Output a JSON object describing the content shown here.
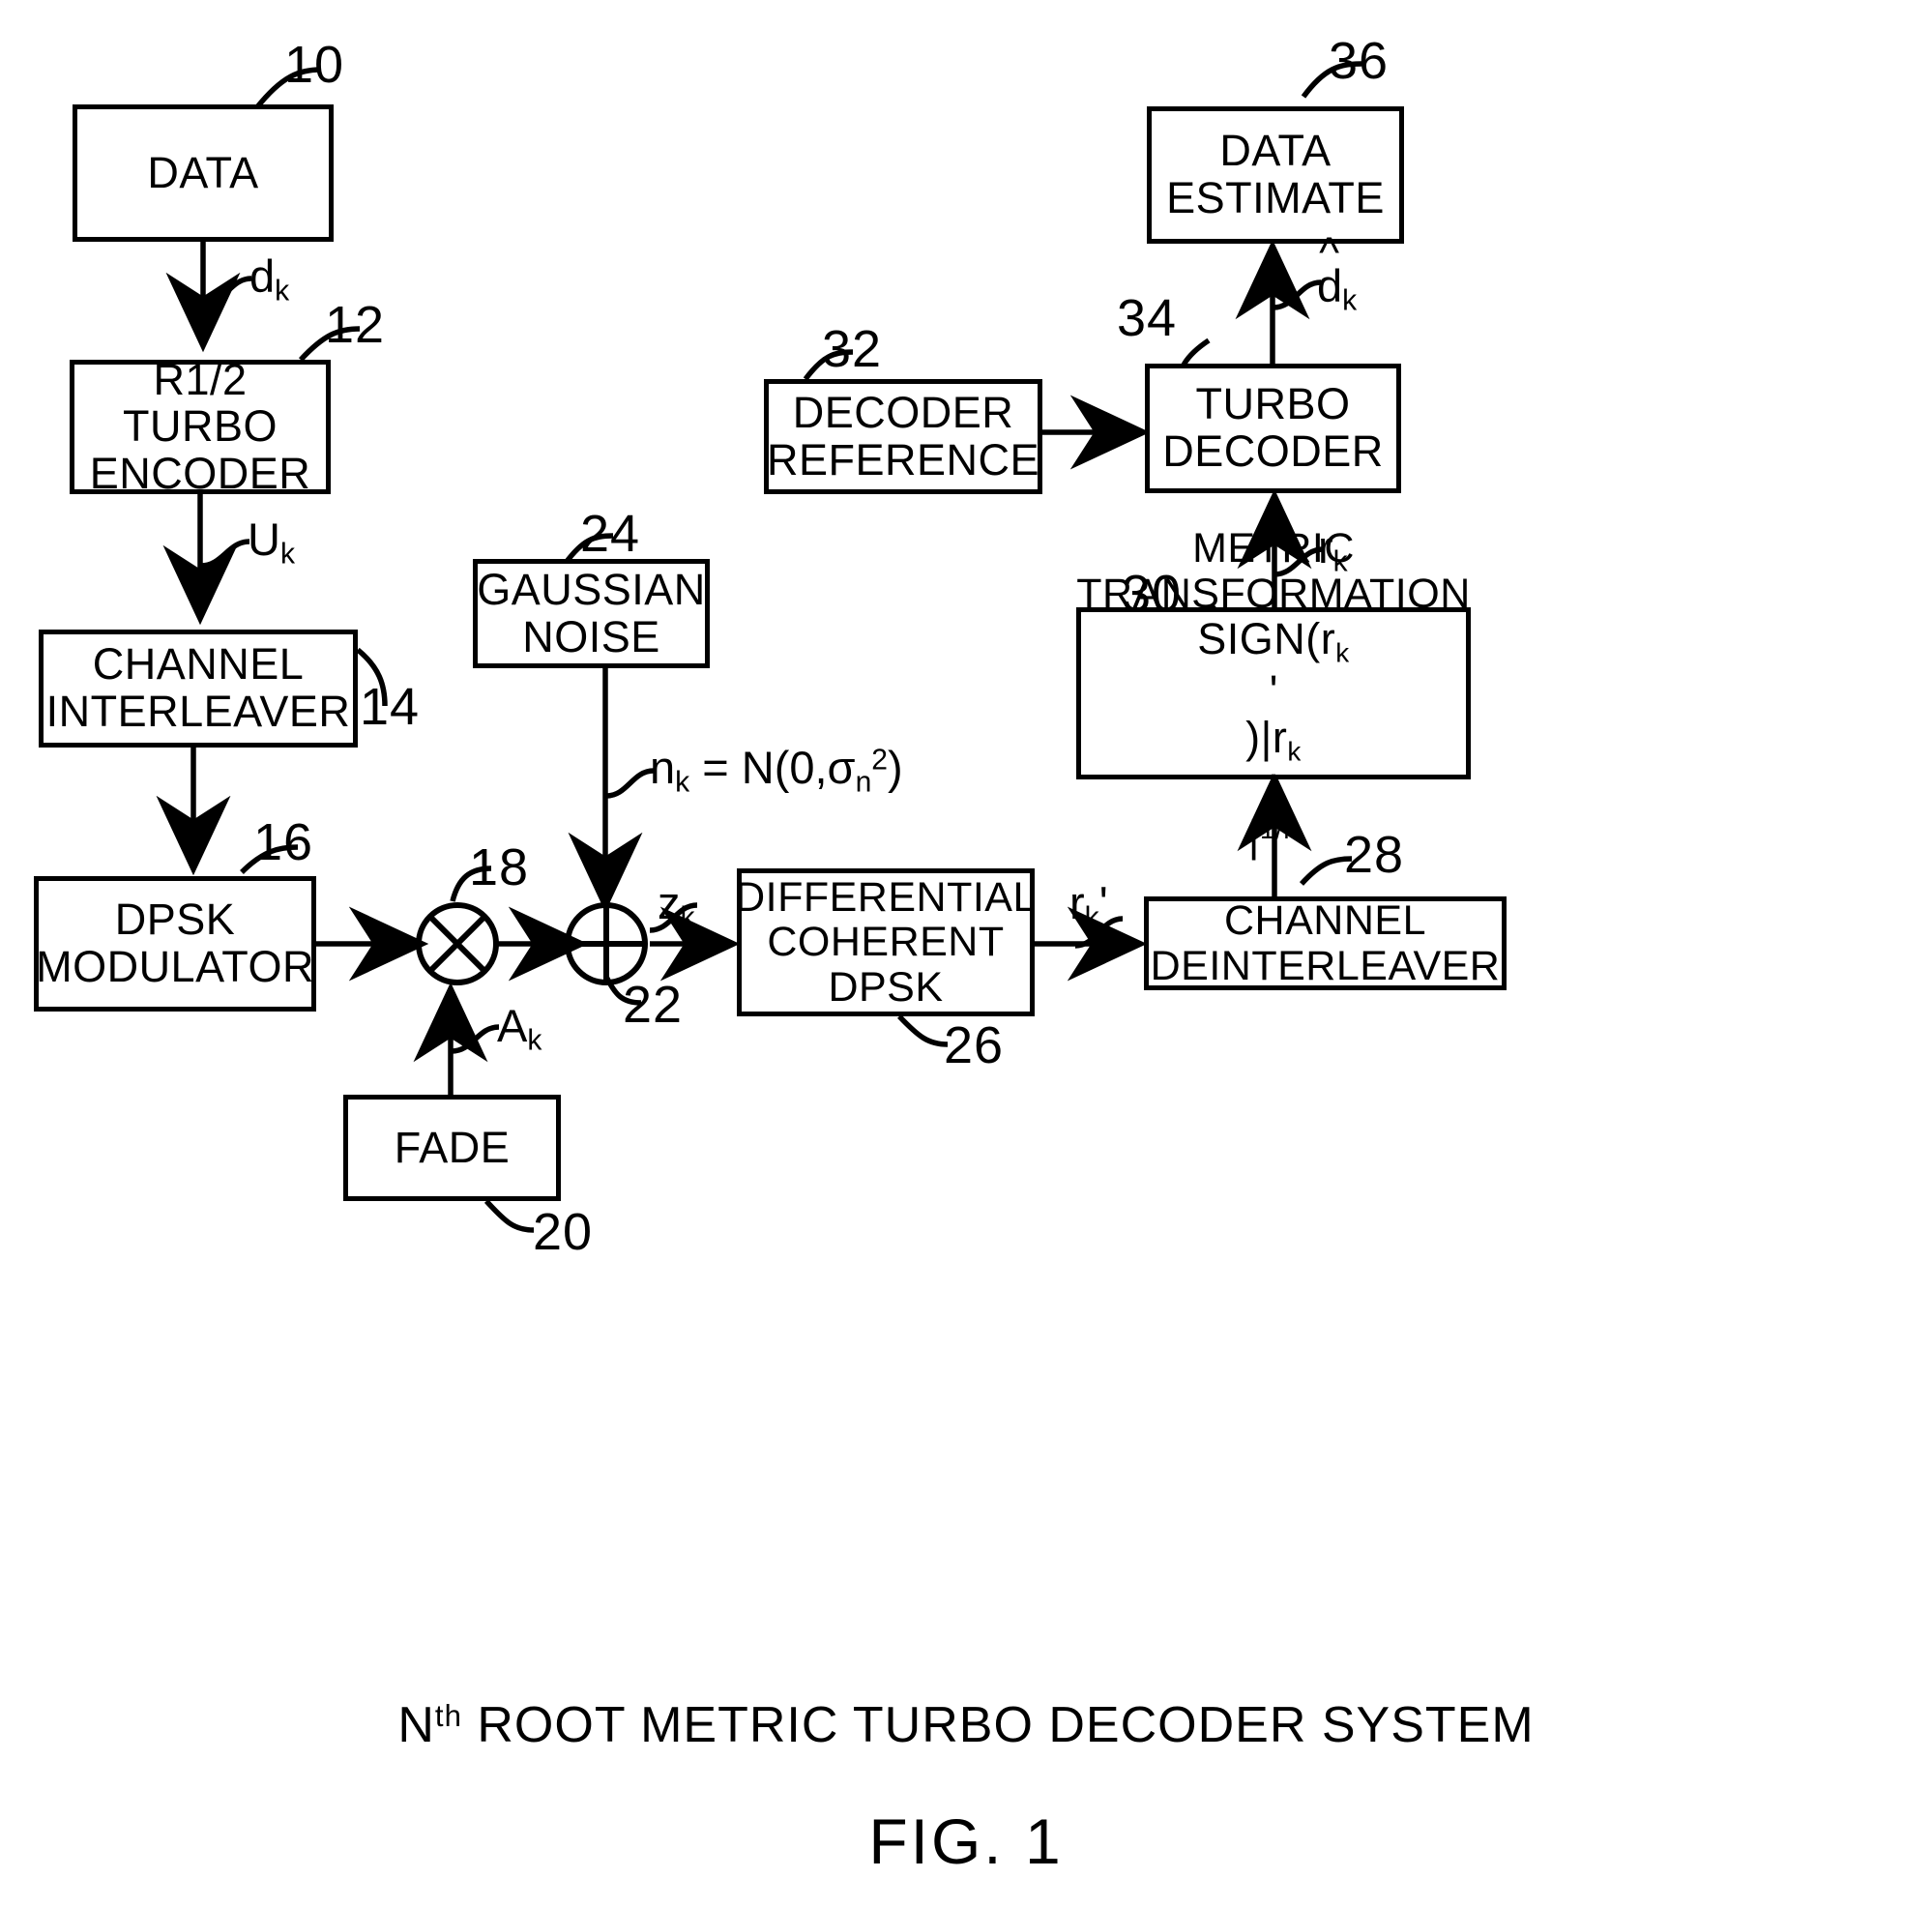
{
  "figure": {
    "caption_prefix": "N",
    "caption_sup": "th",
    "caption_rest": " ROOT METRIC TURBO DECODER SYSTEM",
    "figure_number": "FIG. 1"
  },
  "blocks": {
    "data": {
      "ref": "10",
      "lines": [
        "DATA"
      ]
    },
    "encoder": {
      "ref": "12",
      "lines": [
        "R1/2 TURBO",
        "ENCODER"
      ]
    },
    "interleaver": {
      "ref": "14",
      "lines": [
        "CHANNEL",
        "INTERLEAVER"
      ]
    },
    "modulator": {
      "ref": "16",
      "lines": [
        "DPSK",
        "MODULATOR"
      ]
    },
    "multiplier": {
      "ref": "18",
      "symbol": "circle-times-icon"
    },
    "fade": {
      "ref": "20",
      "lines": [
        "FADE"
      ]
    },
    "summer": {
      "ref": "22",
      "symbol": "circle-plus-icon"
    },
    "noise": {
      "ref": "24",
      "lines": [
        "GAUSSIAN",
        "NOISE"
      ]
    },
    "demod": {
      "ref": "26",
      "lines": [
        "DIFFERENTIAL",
        "COHERENT",
        "DPSK"
      ]
    },
    "deinterleaver": {
      "ref": "28",
      "lines": [
        "CHANNEL",
        "DEINTERLEAVER"
      ]
    },
    "metric": {
      "ref": "30",
      "lines": [
        "METRIC",
        "TRANSFORMATION"
      ],
      "formula": "SIGN(r'k)|r'k|1/n"
    },
    "decoder_reference": {
      "ref": "32",
      "lines": [
        "DECODER",
        "REFERENCE"
      ]
    },
    "turbo_decoder": {
      "ref": "34",
      "lines": [
        "TURBO",
        "DECODER"
      ]
    },
    "data_estimate": {
      "ref": "36",
      "lines": [
        "DATA",
        "ESTIMATE"
      ]
    }
  },
  "signals": {
    "dk": {
      "base": "d",
      "sub": "k"
    },
    "uk": {
      "base": "U",
      "sub": "k"
    },
    "ak": {
      "base": "A",
      "sub": "k"
    },
    "nk": {
      "base": "n",
      "sub": "k",
      "expr": "= N(0,σn2)"
    },
    "zk": {
      "base": "z",
      "sub": "k"
    },
    "rkprime": {
      "base": "r",
      "sub": "k",
      "prime": "'"
    },
    "rk": {
      "base": "r",
      "sub": "k"
    },
    "dkhat": {
      "base": "d",
      "sub": "k",
      "hat": true
    }
  }
}
